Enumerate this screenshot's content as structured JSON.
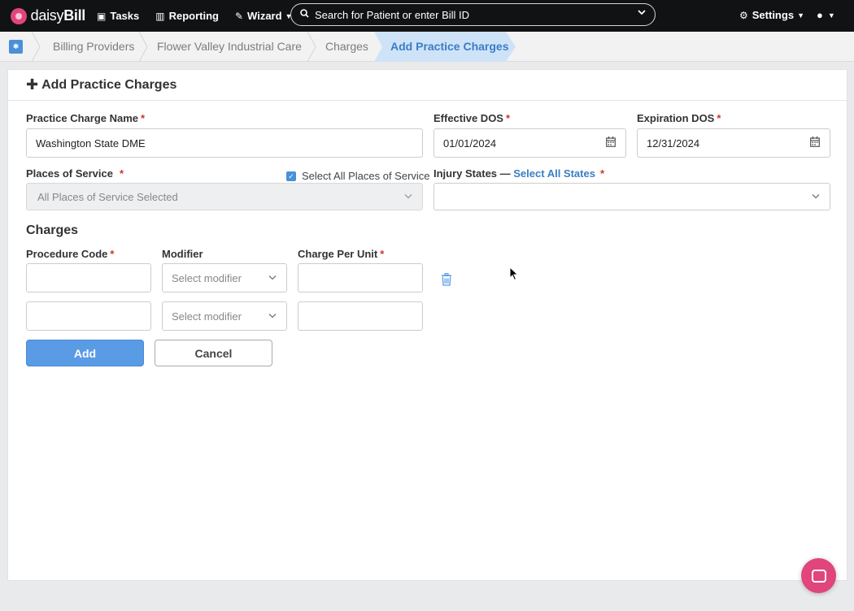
{
  "nav": {
    "logo_light": "daisy",
    "logo_bold": "Bill",
    "tasks": "Tasks",
    "reporting": "Reporting",
    "wizard": "Wizard",
    "search_placeholder": "Search for Patient or enter Bill ID",
    "settings": "Settings"
  },
  "breadcrumb": [
    "Billing Providers",
    "Flower Valley Industrial Care",
    "Charges",
    "Add Practice Charges"
  ],
  "panel": {
    "title": "Add Practice Charges"
  },
  "form": {
    "name_label": "Practice Charge Name",
    "name_value": "Washington State DME",
    "effective_label": "Effective DOS",
    "effective_value": "01/01/2024",
    "expiration_label": "Expiration DOS",
    "expiration_value": "12/31/2024",
    "pos_label": "Places of Service",
    "pos_select_all": "Select All Places of Service",
    "pos_value": "All Places of Service Selected",
    "injury_label": "Injury States —",
    "injury_select_all": "Select All States",
    "required_mark": "*"
  },
  "charges": {
    "title": "Charges",
    "col_procedure": "Procedure Code",
    "col_modifier": "Modifier",
    "col_charge": "Charge Per Unit",
    "modifier_placeholder": "Select modifier",
    "rows": [
      {
        "procedure": "",
        "modifier": "Select modifier",
        "charge": ""
      },
      {
        "procedure": "",
        "modifier": "Select modifier",
        "charge": ""
      }
    ]
  },
  "buttons": {
    "add": "Add",
    "cancel": "Cancel"
  },
  "colors": {
    "primary": "#5a9be6",
    "brand": "#e0457b",
    "required": "#d0342c",
    "link": "#3a7dc4"
  }
}
